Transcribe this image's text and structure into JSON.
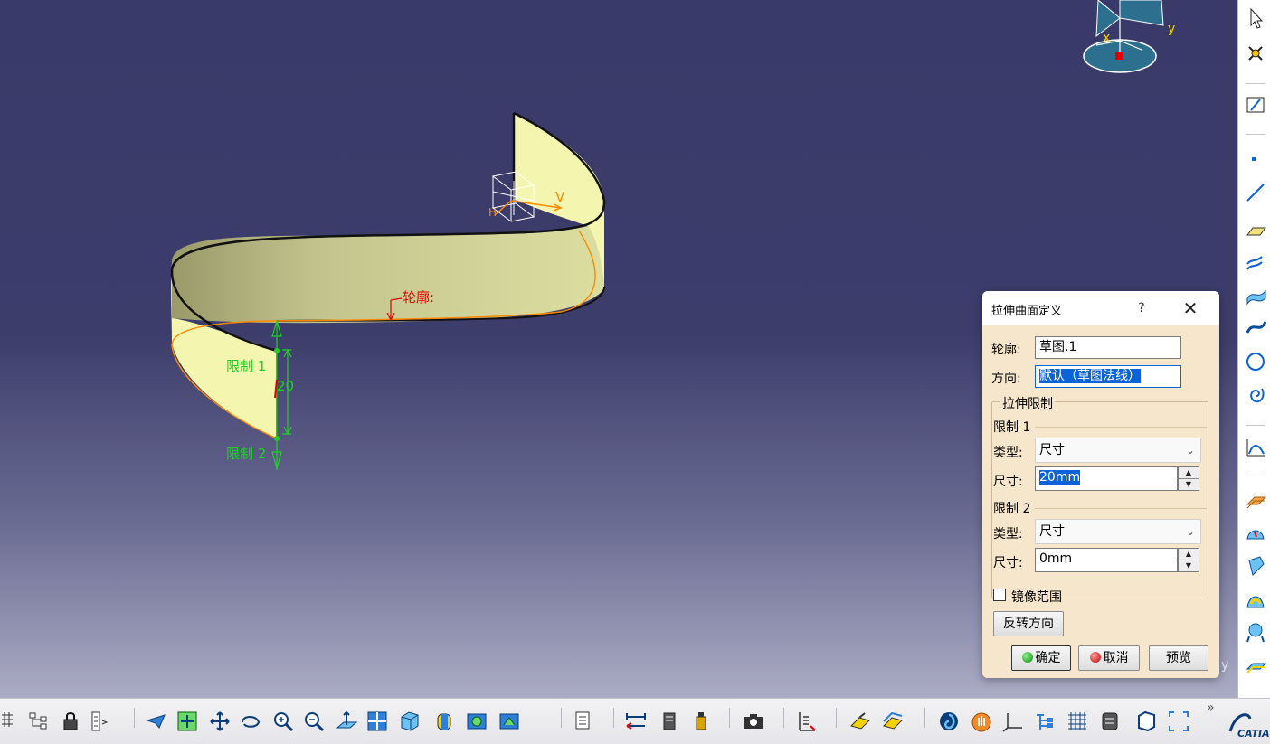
{
  "viewport": {
    "profile_label": "轮廓:",
    "limit1_label": "限制 1",
    "limit2_label": "限制 2",
    "dimension_value": "20",
    "axis_v": "V",
    "axis_h": "H",
    "compass_x": "x",
    "compass_y": "y",
    "corner_y": "y"
  },
  "dialog": {
    "title": "拉伸曲面定义",
    "help": "?",
    "close": "✕",
    "profile_label": "轮廓:",
    "profile_value": "草图.1",
    "direction_label": "方向:",
    "direction_value": "默认（草图法线）",
    "limits_group_title": "拉伸限制",
    "limit1": {
      "heading": "限制 1",
      "type_label": "类型:",
      "type_value": "尺寸",
      "size_label": "尺寸:",
      "size_value": "20mm"
    },
    "limit2": {
      "heading": "限制 2",
      "type_label": "类型:",
      "type_value": "尺寸",
      "size_label": "尺寸:",
      "size_value": "0mm"
    },
    "mirror_label": "镜像范围",
    "mirror_checked": false,
    "reverse_button": "反转方向",
    "ok_button": "确定",
    "cancel_button": "取消",
    "preview_button": "预览"
  },
  "colors": {
    "surface_fill": "#f4f6b0",
    "dimension_green": "#19d51e",
    "profile_red": "#e30000",
    "highlight_blue": "#0b63d8"
  },
  "bottom_toolbar": {
    "more": "»",
    "icons": [
      "grid-icon",
      "tree-icon",
      "lock-icon",
      "filter-icon",
      "fly-icon",
      "fit-all-icon",
      "pan-icon",
      "rotate-icon",
      "zoom-in-icon",
      "zoom-out-icon",
      "normal-view-icon",
      "multi-view-icon",
      "iso-view-icon",
      "shading-icon",
      "hide-show-icon",
      "swap-visible-icon",
      "properties-icon",
      "measure-icon",
      "measure-item-icon",
      "mass-icon",
      "capture-icon",
      "compass-icon",
      "apply-material-icon",
      "render-icon",
      "spin-icon",
      "hand-icon",
      "axis-system-icon",
      "snap-icon",
      "grid-plane-icon",
      "work-on-support-icon",
      "surface-icon",
      "catia-logo"
    ]
  }
}
